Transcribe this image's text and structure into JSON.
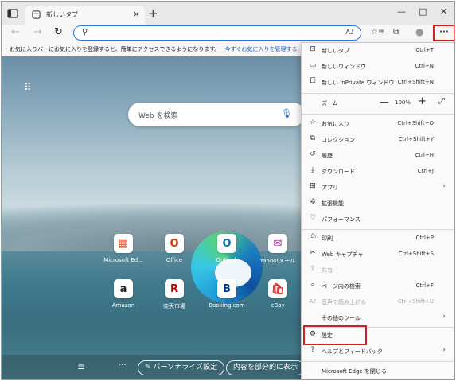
{
  "tab": {
    "title": "新しいタブ",
    "close": "×",
    "new_tab": "+"
  },
  "window": {
    "minimize": "—",
    "maximize": "□",
    "close": "✕"
  },
  "toolbar": {
    "back": "←",
    "forward": "→",
    "reload": "↻",
    "search_icon": "⚲",
    "read_aloud": "A♪",
    "favorites": "☆≡",
    "collections": "⧉",
    "profile": "●",
    "more": "···"
  },
  "favorites_bar": {
    "message": "お気に入りバーにお気に入りを登録すると、簡単にアクセスできるようになります。",
    "link": "今すぐお気に入りを管理する"
  },
  "ntp": {
    "apps_icon": "⠿",
    "search_placeholder": "Web を検索",
    "mic": "🎙",
    "sites": [
      {
        "label": "Microsoft Ed...",
        "glyph": "▦",
        "color": "#f25022"
      },
      {
        "label": "Office",
        "glyph": "O",
        "color": "#d83b01"
      },
      {
        "label": "Outlook",
        "glyph": "O",
        "color": "#0f6cbd"
      },
      {
        "label": "Yahoo!メール",
        "glyph": "✉",
        "color": "#9b1f8a"
      },
      {
        "label": "Amazon",
        "glyph": "a",
        "color": "#222222"
      },
      {
        "label": "楽天市場",
        "glyph": "R",
        "color": "#bf0000"
      },
      {
        "label": "Booking.com",
        "glyph": "B",
        "color": "#003580"
      },
      {
        "label": "eBay",
        "glyph": "🛍",
        "color": "#e53238"
      }
    ],
    "menu_lines": "≡",
    "dots": "···",
    "personalize": "✎ パーソナライズ設定",
    "show_content": "内容を部分的に表示"
  },
  "menu": {
    "new_tab": {
      "label": "新しいタブ",
      "shortcut": "Ctrl+T",
      "icon": "⊡"
    },
    "new_window": {
      "label": "新しいウィンドウ",
      "shortcut": "Ctrl+N",
      "icon": "▭"
    },
    "new_inprivate": {
      "label": "新しい InPrivate ウィンドウ",
      "shortcut": "Ctrl+Shift+N",
      "icon": "⧠"
    },
    "zoom": {
      "label": "ズーム",
      "minus": "—",
      "value": "100%",
      "plus": "+",
      "fullscreen": "⤢"
    },
    "favorites": {
      "label": "お気に入り",
      "shortcut": "Ctrl+Shift+O",
      "icon": "☆"
    },
    "collections": {
      "label": "コレクション",
      "shortcut": "Ctrl+Shift+Y",
      "icon": "⧉"
    },
    "history": {
      "label": "履歴",
      "shortcut": "Ctrl+H",
      "icon": "↺"
    },
    "downloads": {
      "label": "ダウンロード",
      "shortcut": "Ctrl+J",
      "icon": "⤓"
    },
    "apps": {
      "label": "アプリ",
      "icon": "⊞",
      "arrow": "›"
    },
    "extensions": {
      "label": "拡張機能",
      "icon": "✲"
    },
    "performance": {
      "label": "パフォーマンス",
      "icon": "♡"
    },
    "print": {
      "label": "印刷",
      "shortcut": "Ctrl+P",
      "icon": "⎙"
    },
    "web_capture": {
      "label": "Web キャプチャ",
      "shortcut": "Ctrl+Shift+S",
      "icon": "✂"
    },
    "share": {
      "label": "共有",
      "icon": "⇪"
    },
    "find": {
      "label": "ページ内の検索",
      "shortcut": "Ctrl+F",
      "icon": "⌕"
    },
    "read_aloud": {
      "label": "音声で読み上げる",
      "shortcut": "Ctrl+Shift+U",
      "icon": "A♪"
    },
    "more_tools": {
      "label": "その他のツール",
      "arrow": "›"
    },
    "settings": {
      "label": "設定",
      "icon": "⚙"
    },
    "help": {
      "label": "ヘルプとフィードバック",
      "icon": "?",
      "arrow": "›"
    },
    "close_edge": {
      "label": "Microsoft Edge を閉じる"
    }
  }
}
